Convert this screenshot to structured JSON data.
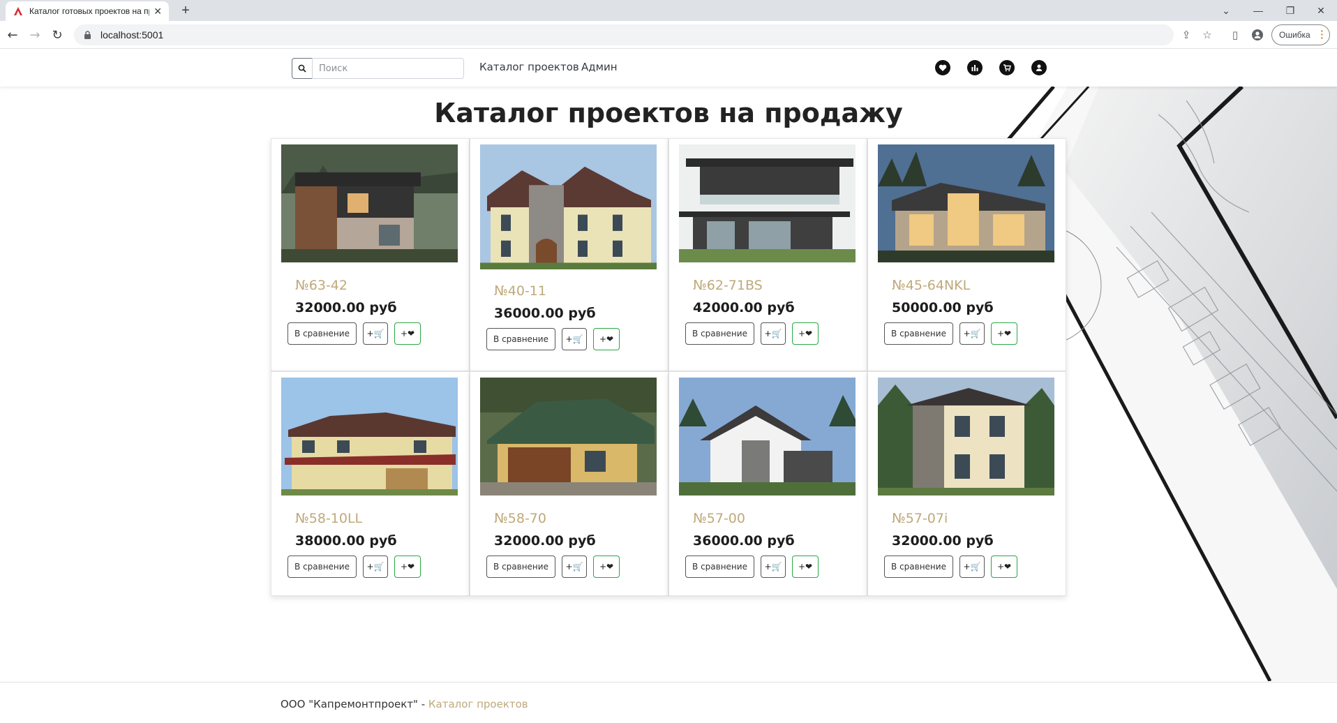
{
  "browser": {
    "tab_title": "Каталог готовых проектов на пр",
    "url": "localhost:5001",
    "error_chip": "Ошибка"
  },
  "nav": {
    "search_placeholder": "Поиск",
    "links": [
      "Каталог проектов",
      "Админ"
    ],
    "icons": [
      "heart-icon",
      "chart-icon",
      "cart-icon",
      "user-icon"
    ]
  },
  "main": {
    "title": "Каталог проектов на продажу",
    "compare_label": "В сравнение",
    "cart_label": "+🛒",
    "fav_label": "+❤",
    "projects": [
      {
        "code": "№63-42",
        "price": "32000.00 руб"
      },
      {
        "code": "№40-11",
        "price": "36000.00 руб"
      },
      {
        "code": "№62-71BS",
        "price": "42000.00 руб"
      },
      {
        "code": "№45-64NKL",
        "price": "50000.00 руб"
      },
      {
        "code": "№58-10LL",
        "price": "38000.00 руб"
      },
      {
        "code": "№58-70",
        "price": "32000.00 руб"
      },
      {
        "code": "№57-00",
        "price": "36000.00 руб"
      },
      {
        "code": "№57-07i",
        "price": "32000.00 руб"
      }
    ]
  },
  "footer": {
    "company": "ООО \"Капремонтпроект\" - ",
    "link": "Каталог проектов"
  },
  "colors": {
    "accent": "#bfa97a",
    "fav_border": "#28a745",
    "chrome": "#dee1e6"
  }
}
